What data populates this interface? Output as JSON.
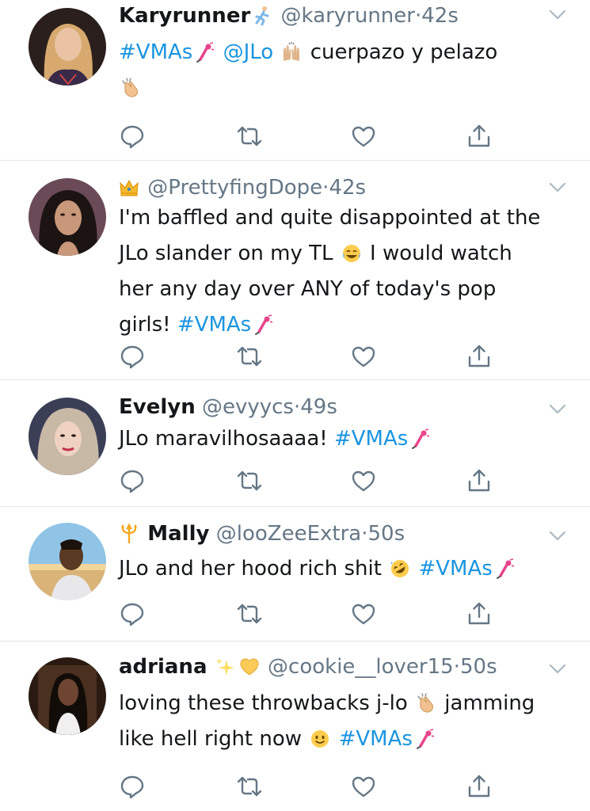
{
  "colors": {
    "link": "#1b95e0",
    "secondary": "#657786",
    "divider": "#e1e8ed",
    "text": "#14171a"
  },
  "tweets": [
    {
      "name": "Karyrunner",
      "handle": "@karyrunner",
      "sep": "·",
      "time": "42s",
      "parts": {
        "hashtag": "#VMAs",
        "mention": "@JLo",
        "text": "cuerpazo y pelazo"
      },
      "emojis": [
        "runner-emoji",
        "microphone-emoji",
        "raised-hands-emoji",
        "clapping-hands-emoji"
      ]
    },
    {
      "name": "",
      "handle": "@PrettyfingDope",
      "sep": "·",
      "time": "42s",
      "parts": {
        "line1": "I'm baffled and quite disappointed at the",
        "line2a": "JLo slander on my TL",
        "line2b": "I would watch",
        "line3": "her any day over ANY of today's pop",
        "line4": "girls!",
        "hashtag": "#VMAs"
      },
      "emojis": [
        "crown-emoji",
        "tears-of-joy-emoji",
        "microphone-emoji"
      ]
    },
    {
      "name": "Evelyn",
      "handle": "@evyycs",
      "sep": "·",
      "time": "49s",
      "parts": {
        "text": "JLo maravilhosaaaa!",
        "hashtag": "#VMAs"
      },
      "emojis": [
        "microphone-emoji"
      ]
    },
    {
      "name": "Mally",
      "handle": "@looZeeExtra",
      "sep": "·",
      "time": "50s",
      "parts": {
        "text": "JLo and her hood rich shit",
        "hashtag": "#VMAs"
      },
      "emojis": [
        "trident-emoji",
        "rofl-emoji",
        "microphone-emoji"
      ]
    },
    {
      "name": "adriana",
      "handle": "@cookie__lover15",
      "sep": "·",
      "time": "50s",
      "parts": {
        "line1a": "loving these throwbacks j-lo",
        "line1b": "jamming",
        "line2": "like hell right now",
        "hashtag": "#VMAs"
      },
      "emojis": [
        "sparkles-emoji",
        "yellow-heart-emoji",
        "clapping-hands-emoji",
        "slight-smile-emoji",
        "microphone-emoji"
      ]
    }
  ]
}
